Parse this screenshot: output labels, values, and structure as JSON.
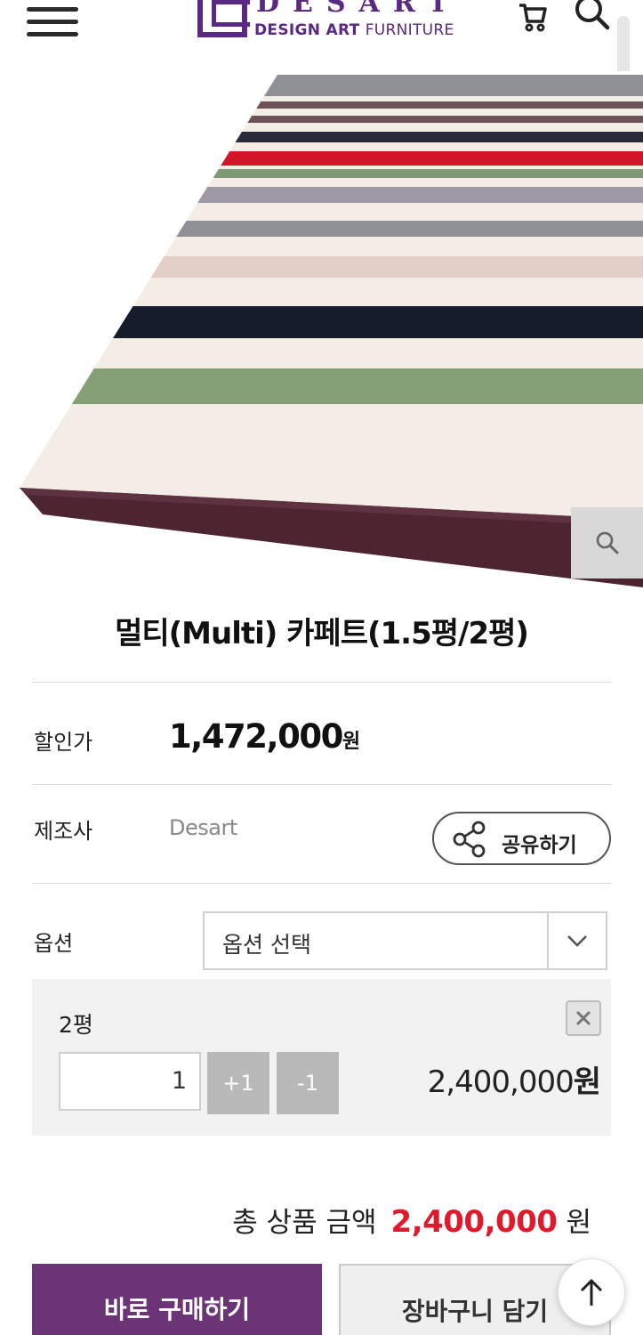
{
  "header": {
    "logo_word": "DESART",
    "logo_tagline_a": "DESIGN ART",
    "logo_tagline_b": "FURNITURE",
    "menu_icon": "hamburger-icon",
    "cart_icon": "cart-icon",
    "search_icon": "search-icon"
  },
  "product": {
    "image_alt_colors": [
      "#8f8f96",
      "#6d5258",
      "#2a2a3a",
      "#d01629",
      "#7d9a74",
      "#9d99a6",
      "#e4cfc6",
      "#171c2c",
      "#85a077",
      "#f4eee6",
      "#4c2530"
    ],
    "zoom_icon": "magnifier-icon",
    "title": "멀티(Multi) 카페트(1.5평/2평)",
    "price_label": "할인가",
    "price_value": "1,472,000",
    "price_unit": "원",
    "maker_label": "제조사",
    "maker_value": "Desart",
    "share_label": "공유하기",
    "option_label": "옵션",
    "option_placeholder": "옵션 선택"
  },
  "selected_option": {
    "name": "2평",
    "quantity": "1",
    "plus_label": "+1",
    "minus_label": "-1",
    "price_number": "2,400,000",
    "price_unit": "원"
  },
  "total": {
    "label": "총 상품 금액",
    "value": "2,400,000",
    "unit": "원",
    "accent_color": "#e01a2c"
  },
  "actions": {
    "buy_label": "바로 구매하기",
    "cart_label": "장바구니 담기",
    "buy_color": "#6b3477"
  }
}
